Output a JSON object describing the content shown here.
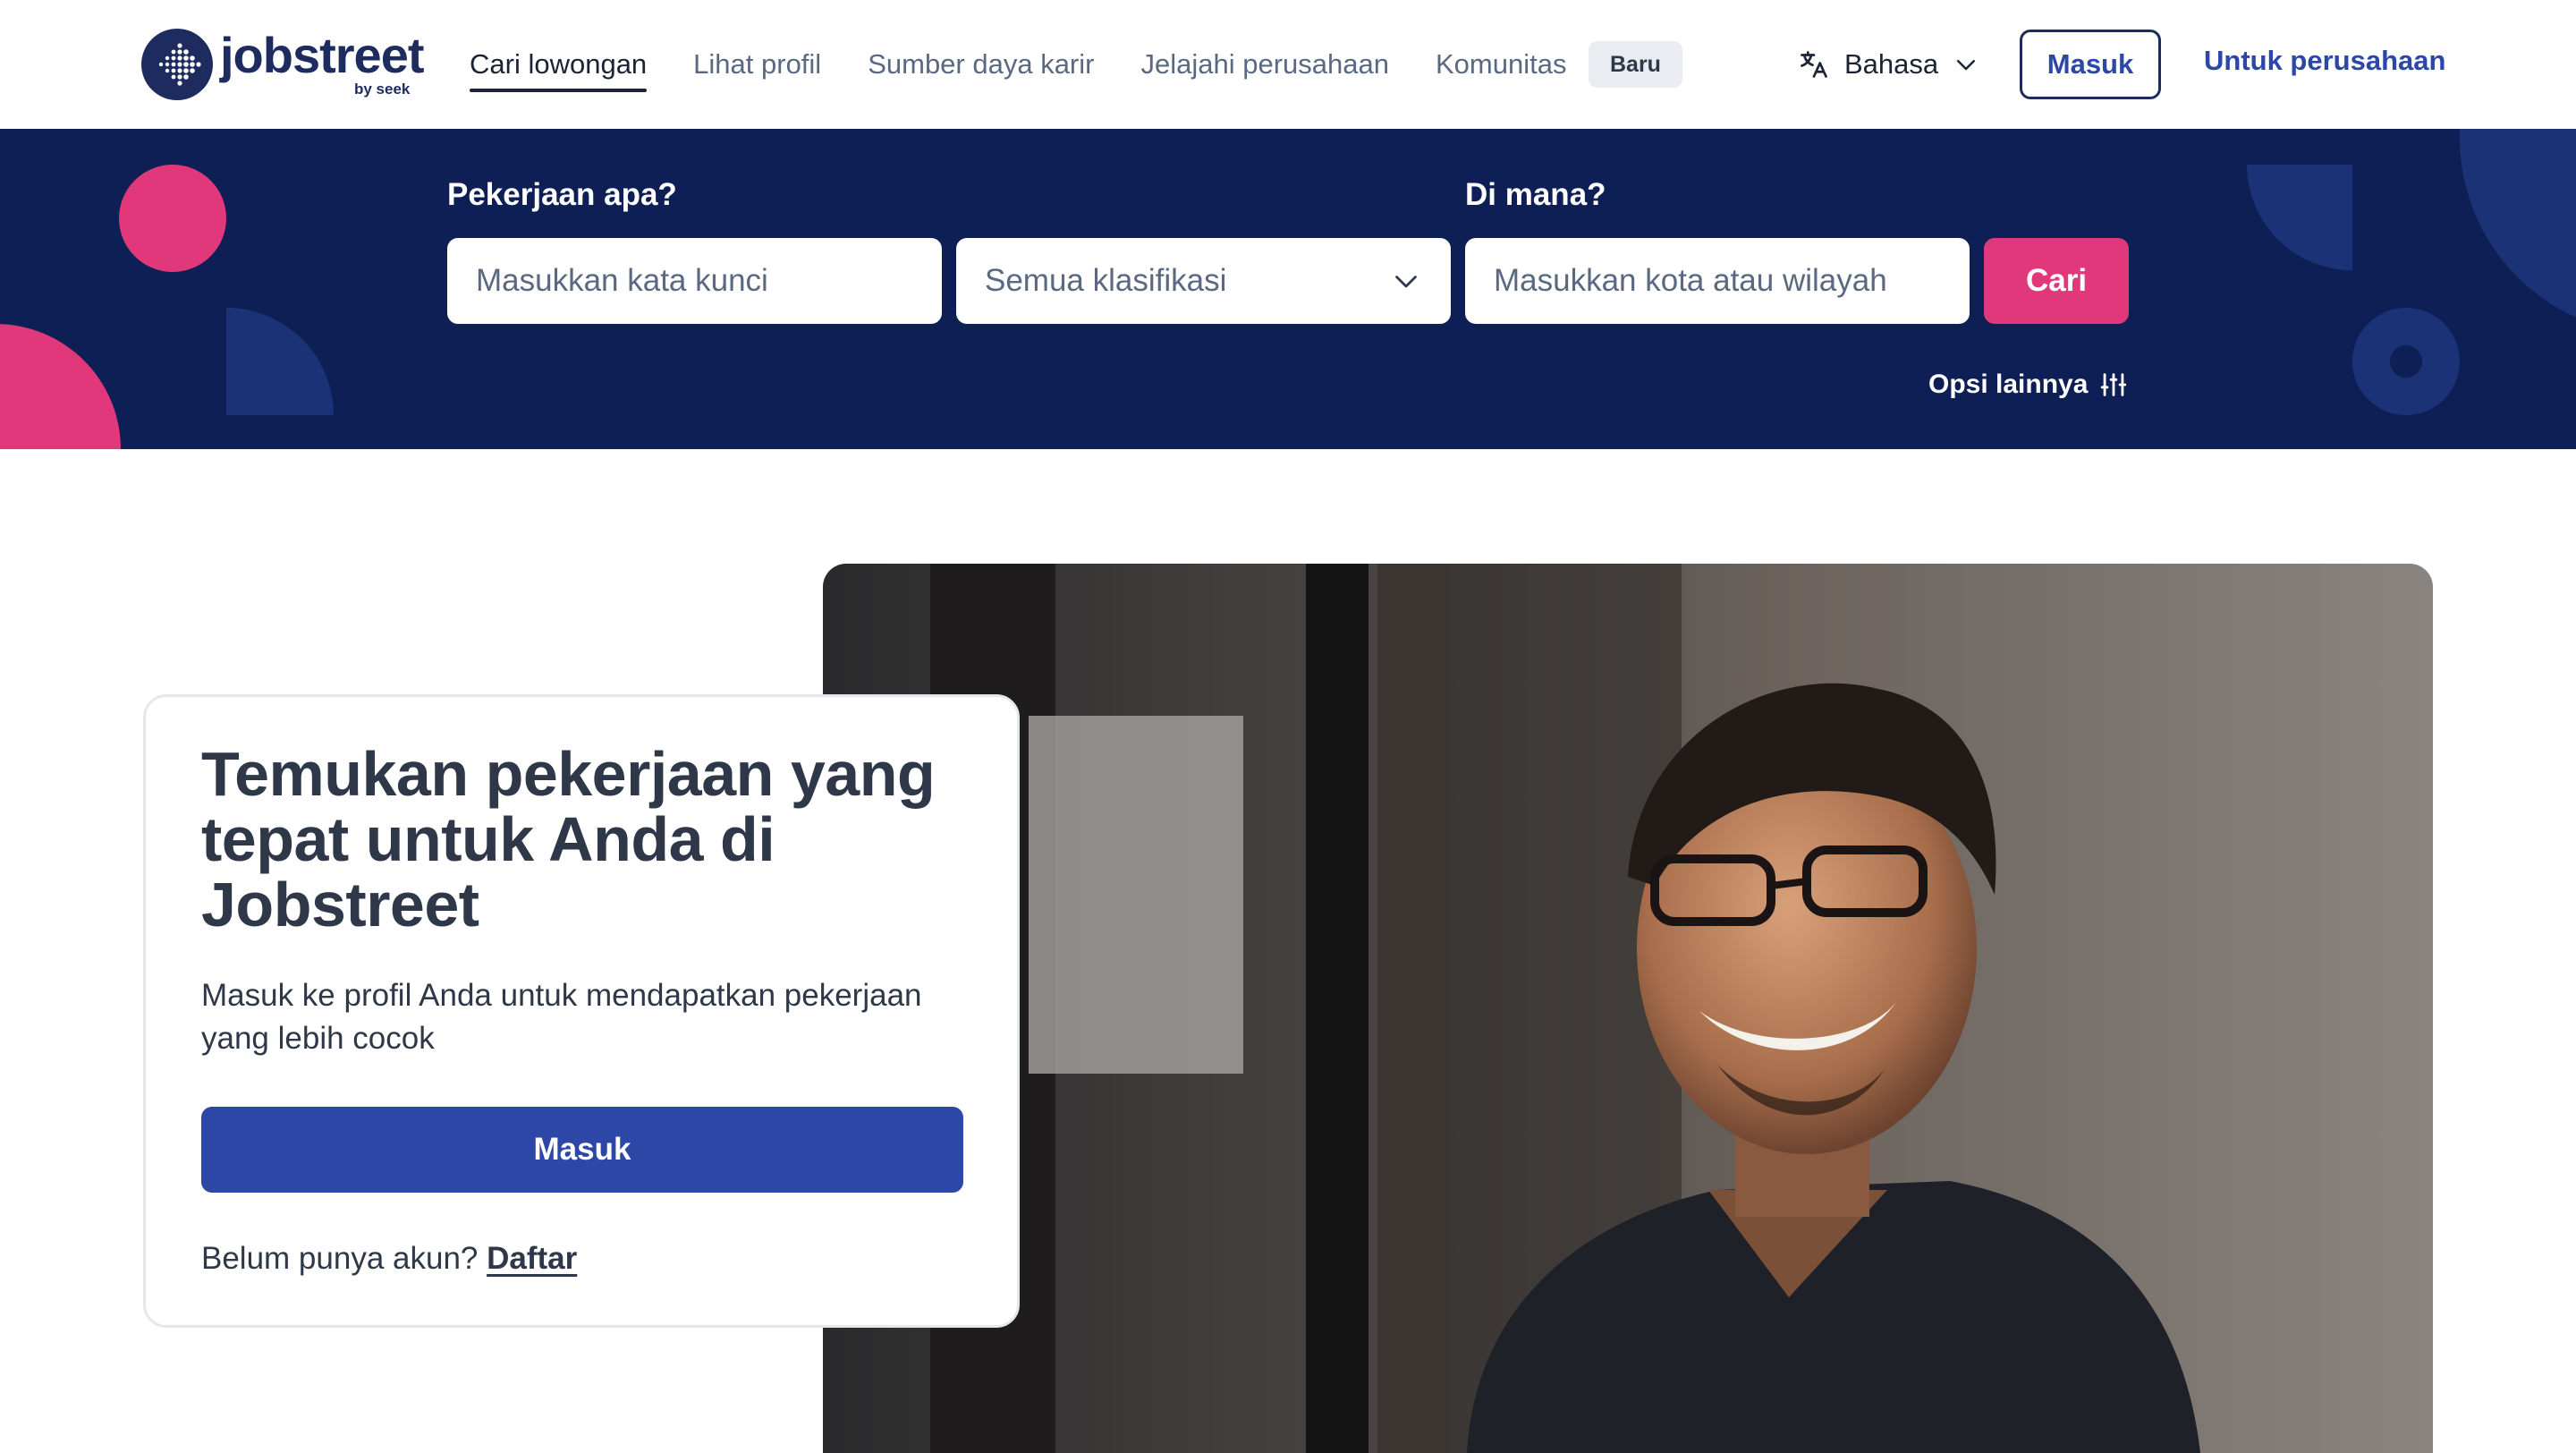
{
  "header": {
    "logo": {
      "name": "jobstreet",
      "sub": "by seek"
    },
    "nav": [
      {
        "label": "Cari lowongan",
        "active": true
      },
      {
        "label": "Lihat profil",
        "active": false
      },
      {
        "label": "Sumber daya karir",
        "active": false
      },
      {
        "label": "Jelajahi perusahaan",
        "active": false
      },
      {
        "label": "Komunitas",
        "active": false
      }
    ],
    "nav_badge": "Baru",
    "language_label": "Bahasa",
    "signin_label": "Masuk",
    "employer_label": "Untuk perusahaan"
  },
  "search": {
    "what_label": "Pekerjaan apa?",
    "keyword_placeholder": "Masukkan kata kunci",
    "classification_value": "Semua klasifikasi",
    "where_label": "Di mana?",
    "location_placeholder": "Masukkan kota atau wilayah",
    "search_button": "Cari",
    "more_options": "Opsi lainnya"
  },
  "hero": {
    "title": "Temukan pekerjaan yang tepat untuk Anda di Jobstreet",
    "subtitle": "Masuk ke profil Anda untuk mendapatkan pekerjaan yang lebih cocok",
    "signin_button": "Masuk",
    "signup_prompt": "Belum punya akun?",
    "signup_link": "Daftar"
  },
  "colors": {
    "brand_navy": "#0e1f55",
    "primary_blue": "#2c47a6",
    "accent_pink": "#e0387a",
    "text_dark": "#2e3849"
  },
  "icons": [
    "jobstreet-logo-icon",
    "translate-icon",
    "chevron-down-icon",
    "sliders-icon"
  ]
}
